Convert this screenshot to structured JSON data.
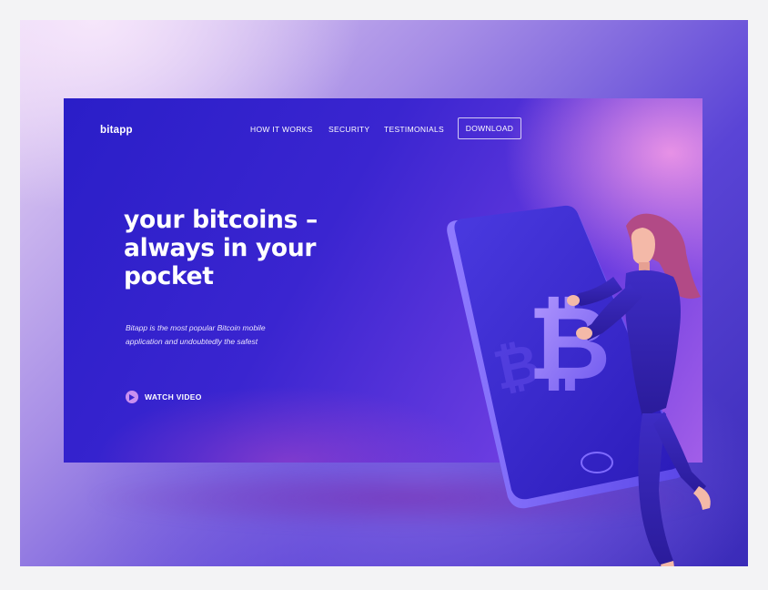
{
  "brand": {
    "name": "bitapp"
  },
  "nav": {
    "items": [
      {
        "label": "HOW IT WORKS"
      },
      {
        "label": "SECURITY"
      },
      {
        "label": "TESTIMONIALS"
      }
    ],
    "download_label": "DOWNLOAD"
  },
  "hero": {
    "headline_lines": [
      "your bitcoins –",
      "always in your",
      "pocket"
    ],
    "subtext_lines": [
      "Bitapp is the most popular Bitcoin mobile",
      "application and undoubtedly the safest"
    ],
    "watch_video_label": "WATCH VIDEO"
  },
  "icons": {
    "play": "play-icon",
    "bitcoin": "bitcoin-icon"
  },
  "colors": {
    "hero_start": "#2a1ec8",
    "hero_end": "#a25ee8",
    "accent": "#c98ff0",
    "text": "#ffffff"
  }
}
